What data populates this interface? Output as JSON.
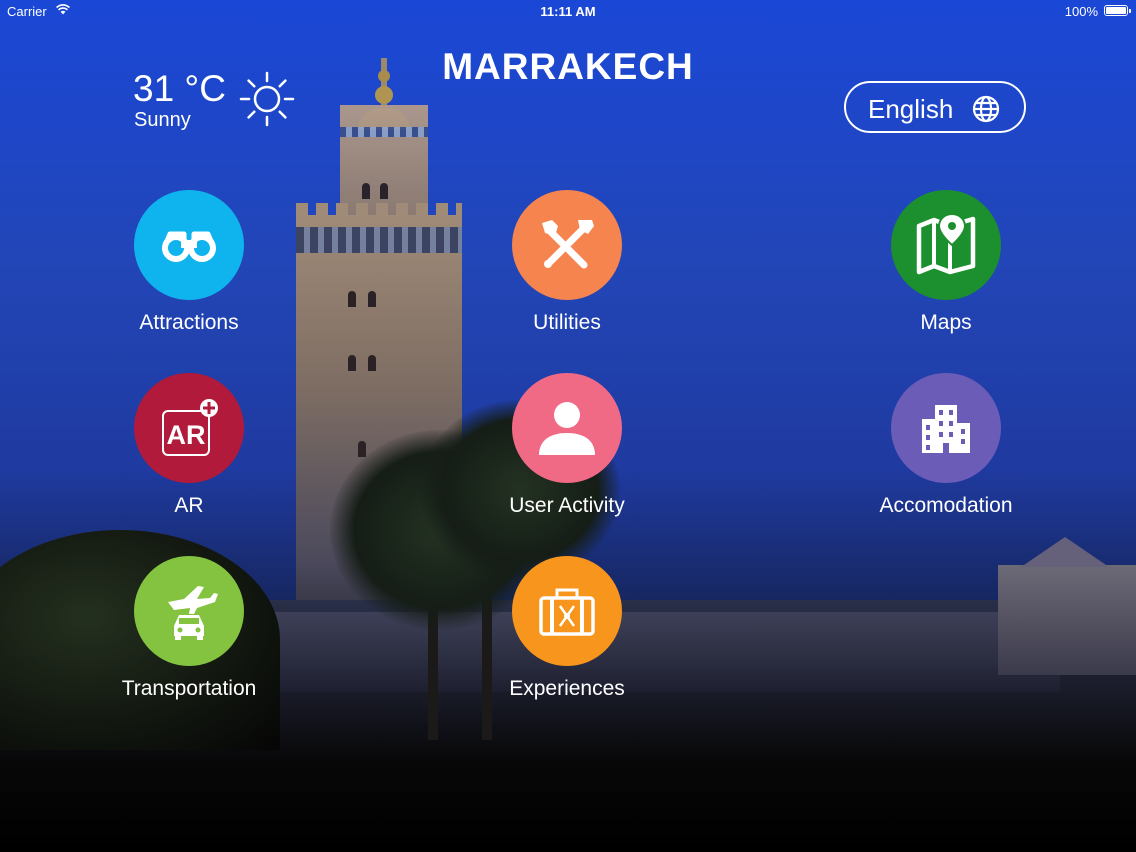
{
  "status_bar": {
    "carrier": "Carrier",
    "time": "11:11 AM",
    "battery": "100%"
  },
  "header": {
    "title": "MARRAKECH"
  },
  "weather": {
    "temperature": "31 °C",
    "condition": "Sunny",
    "icon": "sun-icon"
  },
  "language": {
    "label": "English",
    "icon": "globe-icon"
  },
  "tiles": [
    {
      "label": "Attractions",
      "icon": "binoculars-icon",
      "color": "#0fb4ee"
    },
    {
      "label": "Utilities",
      "icon": "tools-icon",
      "color": "#f5844f"
    },
    {
      "label": "Maps",
      "icon": "map-icon",
      "color": "#1c8f2e"
    },
    {
      "label": "AR",
      "icon": "ar-icon",
      "icon_text": "AR",
      "color": "#b11a3a"
    },
    {
      "label": "User Activity",
      "icon": "user-icon",
      "color": "#f06a86"
    },
    {
      "label": "Accomodation",
      "icon": "building-icon",
      "color": "#6b5cb8"
    },
    {
      "label": "Transportation",
      "icon": "transport-icon",
      "color": "#83c340"
    },
    {
      "label": "Experiences",
      "icon": "suitcase-icon",
      "color": "#f7951c"
    }
  ]
}
